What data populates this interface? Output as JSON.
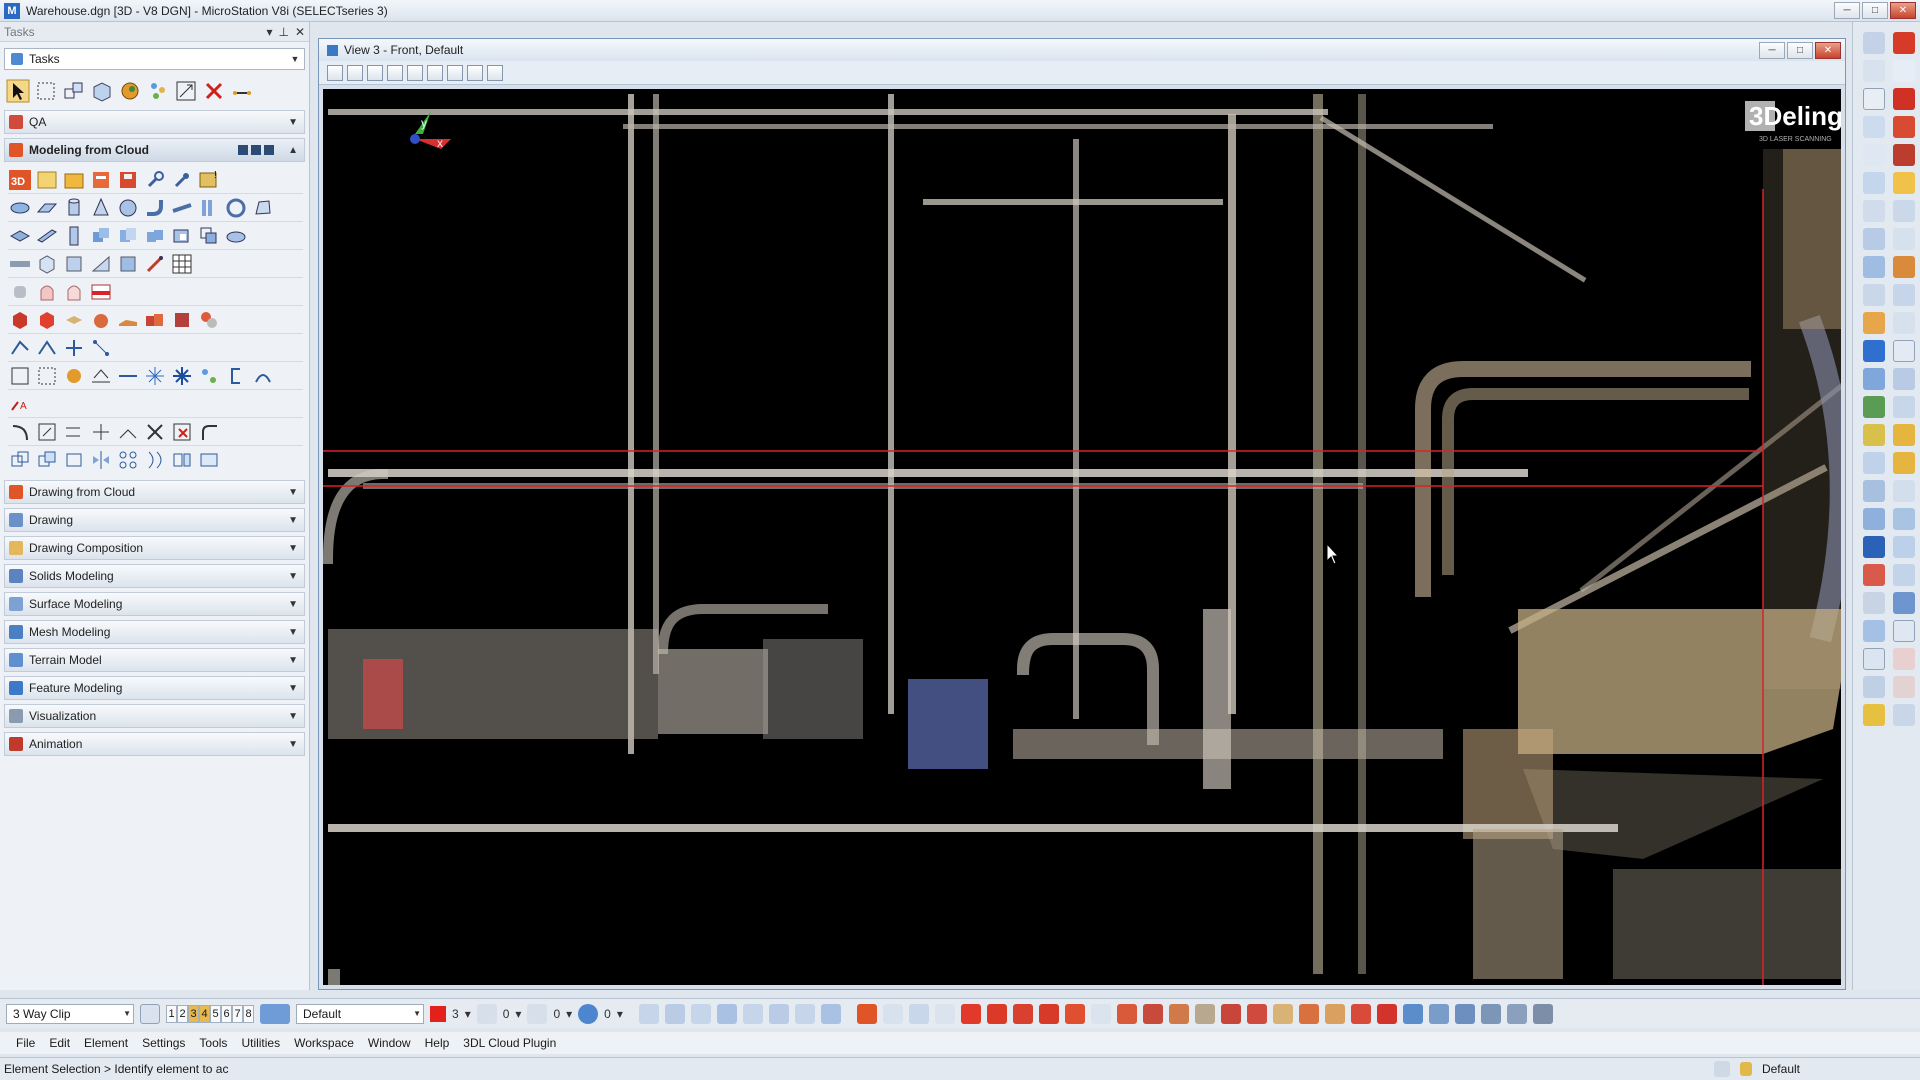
{
  "window": {
    "title": "Warehouse.dgn [3D - V8 DGN] - MicroStation V8i (SELECTseries 3)"
  },
  "tasks_panel": {
    "header": "Tasks",
    "selector": "Tasks",
    "qa_section": "QA",
    "open_section": "Modeling from Cloud",
    "sections": [
      "Drawing from Cloud",
      "Drawing",
      "Drawing Composition",
      "Solids Modeling",
      "Surface Modeling",
      "Mesh Modeling",
      "Terrain Model",
      "Feature Modeling",
      "Visualization",
      "Animation"
    ]
  },
  "view": {
    "title": "View 3 - Front, Default",
    "watermark": "3Deling",
    "watermark_sub": "3D LASER SCANNING",
    "axis_labels": {
      "x": "x",
      "y": "y"
    }
  },
  "bottom_toolbar": {
    "clip_mode": "3 Way Clip",
    "view_numbers": [
      "1",
      "2",
      "3",
      "4",
      "5",
      "6",
      "7",
      "8"
    ],
    "level": "Default",
    "color_value": "3",
    "style_value": "0",
    "weight_value": "0",
    "transparency_value": "0"
  },
  "menu": [
    "File",
    "Edit",
    "Element",
    "Settings",
    "Tools",
    "Utilities",
    "Workspace",
    "Window",
    "Help",
    "3DL Cloud Plugin"
  ],
  "status": {
    "prompt": "Element Selection > Identify element to ac",
    "right_text": "Default"
  },
  "colors": {
    "accent_red": "#d8232a",
    "view_bg": "#000000",
    "section_3d": "#e05528"
  }
}
